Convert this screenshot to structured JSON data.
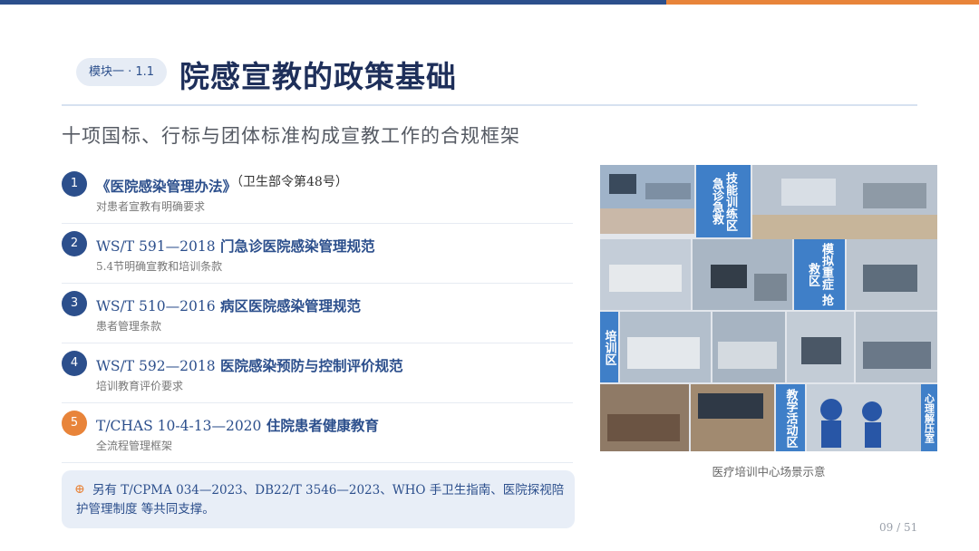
{
  "header": {
    "module_tag": "模块一 · 1.1",
    "title": "院感宣教的政策基础",
    "subtitle": "十项国标、行标与团体标准构成宣教工作的合规框架"
  },
  "standards": [
    {
      "num": "1",
      "code": "",
      "name": "《医院感染管理办法》",
      "extra": "（卫生部令第48号）",
      "desc": "对患者宣教有明确要求"
    },
    {
      "num": "2",
      "code": "WS/T 591—2018",
      "name": "门急诊医院感染管理规范",
      "extra": "",
      "desc": "5.4节明确宣教和培训条款"
    },
    {
      "num": "3",
      "code": "WS/T 510—2016",
      "name": "病区医院感染管理规范",
      "extra": "",
      "desc": "患者管理条款"
    },
    {
      "num": "4",
      "code": "WS/T 592—2018",
      "name": "医院感染预防与控制评价规范",
      "extra": "",
      "desc": "培训教育评价要求"
    },
    {
      "num": "5",
      "code": "T/CHAS 10-4-13—2020",
      "name": "住院患者健康教育",
      "extra": "",
      "desc": "全流程管理框架"
    }
  ],
  "note": {
    "icon": "plus-circle-icon",
    "text": "另有 T/CPMA 034—2023、DB22/T 3546—2023、WHO 手卫生指南、医院探视陪护管理制度 等共同支撑。"
  },
  "photo_panel": {
    "labels": {
      "skills": "技能训练区 急诊急救",
      "rescue": "模拟重症 抢救区",
      "training": "培训区",
      "teaching": "教学活动区",
      "psych": "心理解压室"
    },
    "caption": "医疗培训中心场景示意"
  },
  "colors": {
    "primary": "#2c4f8c",
    "accent": "#e8843a",
    "label_blue": "#3f7fc8"
  },
  "page": {
    "indicator": "09 / 51"
  }
}
